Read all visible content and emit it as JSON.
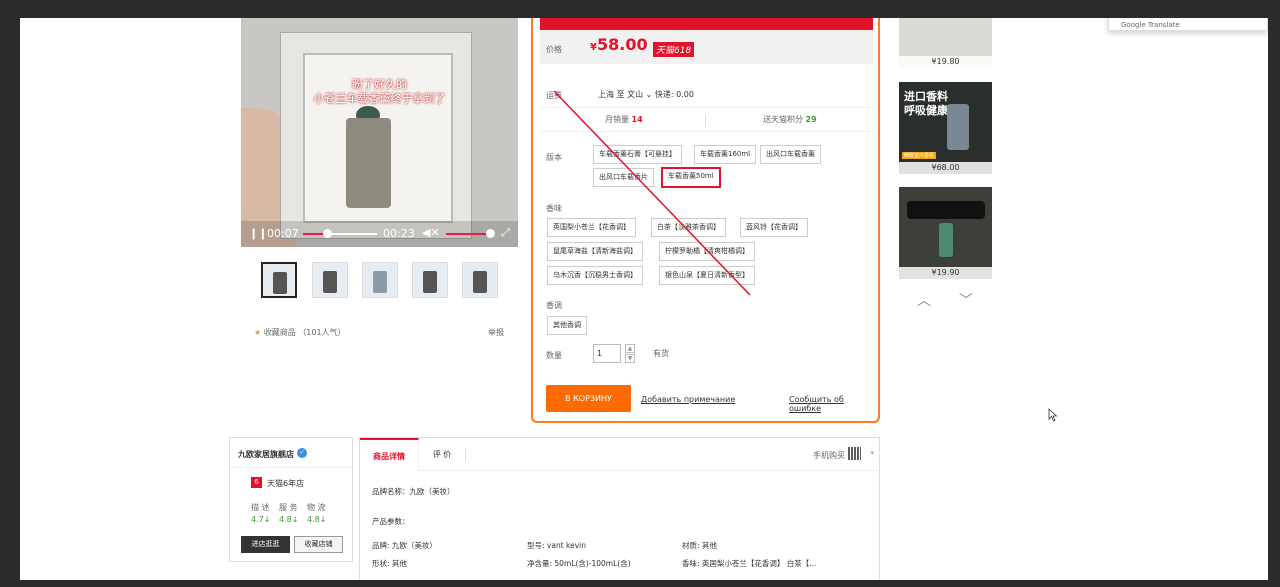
{
  "gallery": {
    "caption_line1": "盼了好久的",
    "caption_line2": "小苍兰车载香薰终于拿到了",
    "video_time_current": "00:07",
    "video_time_total": "00:23",
    "video_progress": 0.33,
    "thumbnails": 5,
    "favorite_label": "收藏商品",
    "favorite_count": "（101人气）",
    "report_label": "举报"
  },
  "product": {
    "price_label": "价格",
    "price_currency": "¥",
    "price_value": "58.00",
    "price_badge": "天猫618",
    "shipping_label": "运费",
    "shipping_route": "上海 至 文山",
    "shipping_fee": "快递: 0.00",
    "monthly_sales_label": "月销量",
    "monthly_sales_value": "14",
    "points_label": "送天猫积分",
    "points_value": "29",
    "version_label": "版本",
    "versions": [
      "车载香薰石膏【可悬挂】",
      "车载香薰160ml",
      "出风口车载香薰",
      "出风口车载香片",
      "车载香薰50ml"
    ],
    "scent_label": "香味",
    "scents": [
      "英国梨小苍兰【花香调】",
      "白茶【淡雅茶香调】",
      "蓝风铃【花香调】",
      "鼠尾草海盐【清新海盐调】",
      "柠檬罗勒橘【清爽柑橘调】",
      "乌木沉香【沉稳男士香调】",
      "银色山泉【夏日清新香型】"
    ],
    "tone_label": "香调",
    "tone_option": "其他香调",
    "qty_label": "数量",
    "qty_value": "1",
    "qty_up": "▲",
    "qty_down": "▼",
    "stock": "有货",
    "cart_button": "В КОРЗИНУ",
    "add_note_link": "Добавить примечание",
    "report_error_link": "Сообщить об ошибке"
  },
  "recommendations": {
    "prices": [
      "¥19.80",
      "¥68.00",
      "¥19.90"
    ],
    "promo_title_line1": "进口香料",
    "promo_title_line2": "呼吸健康",
    "promo_tag": "精致室内香氛",
    "arrow_up": "︿",
    "arrow_down": "﹀"
  },
  "popup": {
    "text": "Google Translate"
  },
  "shop": {
    "name": "九欧家居旗舰店",
    "badge": "✓",
    "years_icon": "6",
    "years": "天猫6年店",
    "metrics": [
      "描 述",
      "服 务",
      "物 流"
    ],
    "scores": [
      "4.7↓",
      "4.8↓",
      "4.8↓"
    ],
    "visit_button": "进店逛逛",
    "follow_button": "收藏店铺"
  },
  "details": {
    "tab_details": "商品详情",
    "tab_reviews": "评 价",
    "mobile_buy": "手机购买",
    "dropdown": "▾",
    "brand_name": "品牌名称：九欧（美妆）",
    "params_title": "产品参数：",
    "params": [
      [
        "品牌: 九欧（美妆）",
        "型号: vant kevin",
        "材质: 其他"
      ],
      [
        "形状: 其他",
        "净含量: 50mL(含)-100mL(含)",
        "香味: 英国梨小苍兰【花香调】 白茶【..."
      ]
    ]
  },
  "colors": {
    "accent_red": "#e4112a",
    "accent_orange": "#ff6a00",
    "panel_border": "#ff7a26",
    "score_green": "#3b9a32"
  }
}
